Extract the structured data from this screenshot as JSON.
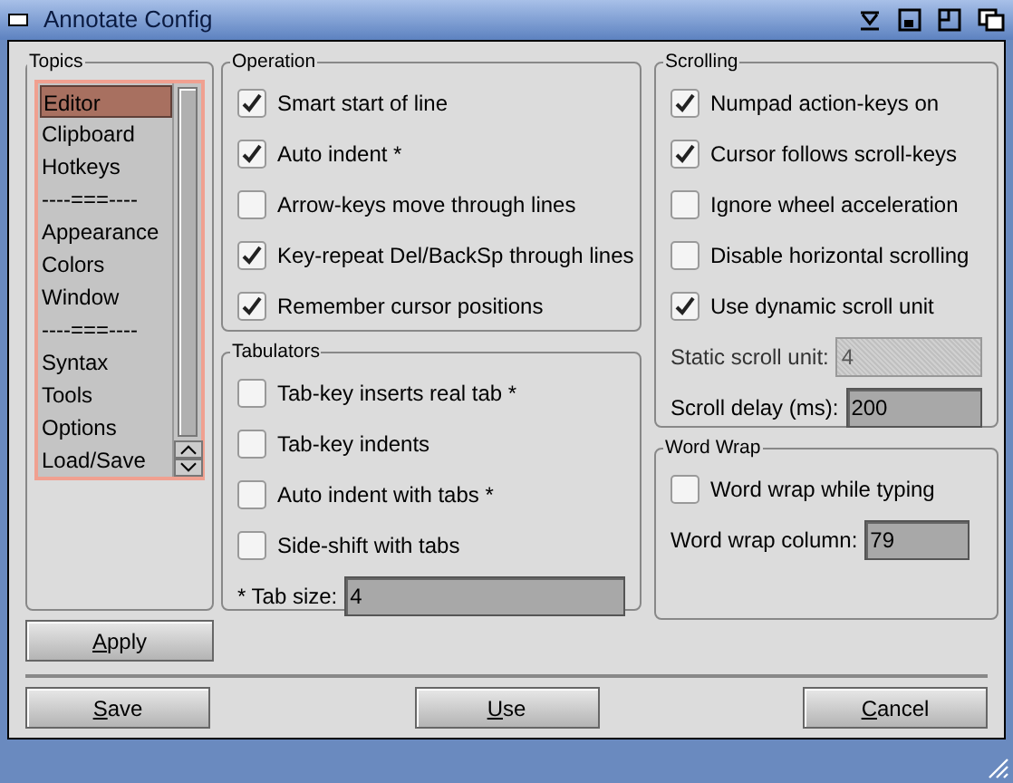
{
  "window": {
    "title": "Annotate Config"
  },
  "topics": {
    "title": "Topics",
    "items": [
      {
        "label": "Editor",
        "selected": true
      },
      {
        "label": "Clipboard",
        "selected": false
      },
      {
        "label": "Hotkeys",
        "selected": false
      },
      {
        "label": "----===----",
        "selected": false
      },
      {
        "label": "Appearance",
        "selected": false
      },
      {
        "label": "Colors",
        "selected": false
      },
      {
        "label": "Window",
        "selected": false
      },
      {
        "label": "----===----",
        "selected": false
      },
      {
        "label": "Syntax",
        "selected": false
      },
      {
        "label": "Tools",
        "selected": false
      },
      {
        "label": "Options",
        "selected": false
      },
      {
        "label": "Load/Save",
        "selected": false
      }
    ]
  },
  "apply_button": {
    "label": "Apply",
    "first_letter_underlined": true
  },
  "operation": {
    "title": "Operation",
    "options": [
      {
        "label": "Smart start of line",
        "checked": true
      },
      {
        "label": "Auto indent *",
        "checked": true
      },
      {
        "label": "Arrow-keys move through lines",
        "checked": false
      },
      {
        "label": "Key-repeat Del/BackSp through lines",
        "checked": true
      },
      {
        "label": "Remember cursor positions",
        "checked": true
      }
    ]
  },
  "tabulators": {
    "title": "Tabulators",
    "options": [
      {
        "label": "Tab-key inserts real tab *",
        "checked": false
      },
      {
        "label": "Tab-key indents",
        "checked": false
      },
      {
        "label": "Auto indent with tabs *",
        "checked": false
      },
      {
        "label": "Side-shift with tabs",
        "checked": false
      }
    ],
    "fields": [
      {
        "label": "* Tab size:",
        "value": "4",
        "disabled": false
      }
    ]
  },
  "scrolling": {
    "title": "Scrolling",
    "options": [
      {
        "label": "Numpad action-keys on",
        "checked": true
      },
      {
        "label": "Cursor follows scroll-keys",
        "checked": true
      },
      {
        "label": "Ignore wheel acceleration",
        "checked": false
      },
      {
        "label": "Disable horizontal scrolling",
        "checked": false
      },
      {
        "label": "Use dynamic scroll unit",
        "checked": true
      }
    ],
    "fields": [
      {
        "label": "Static scroll unit:",
        "value": "4",
        "disabled": true
      },
      {
        "label": "Scroll delay (ms):",
        "value": "200",
        "disabled": false
      }
    ]
  },
  "word_wrap": {
    "title": "Word Wrap",
    "options": [
      {
        "label": "Word wrap while typing",
        "checked": false
      }
    ],
    "fields": [
      {
        "label": "Word wrap column:",
        "value": "79",
        "disabled": false
      }
    ]
  },
  "buttons": [
    {
      "label": "Save",
      "first_letter_underlined": true
    },
    {
      "label": "Use",
      "first_letter_underlined": true
    },
    {
      "label": "Cancel",
      "first_letter_underlined": true
    }
  ]
}
